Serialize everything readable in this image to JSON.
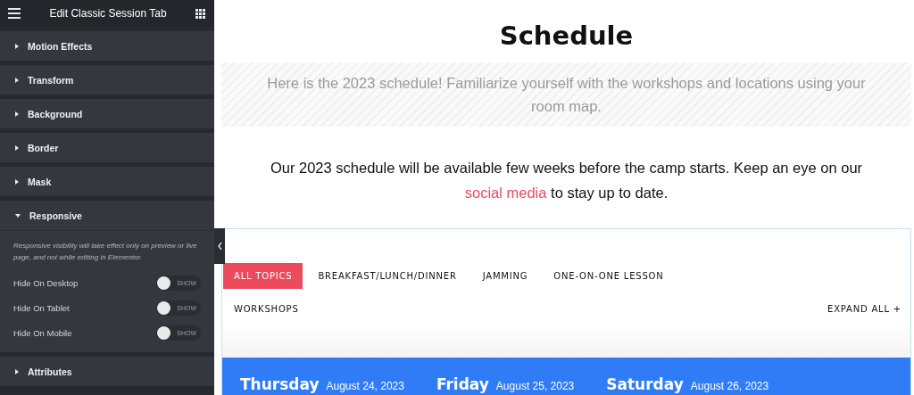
{
  "panel": {
    "title": "Edit Classic Session Tab",
    "sections": [
      {
        "label": "Motion Effects",
        "expanded": false
      },
      {
        "label": "Transform",
        "expanded": false
      },
      {
        "label": "Background",
        "expanded": false
      },
      {
        "label": "Border",
        "expanded": false
      },
      {
        "label": "Mask",
        "expanded": false
      },
      {
        "label": "Responsive",
        "expanded": true,
        "note": "Responsive visibility will take effect only on preview or live page, and not while editing in Elementor.",
        "toggles": [
          {
            "label": "Hide On Desktop",
            "on": false,
            "state": "SHOW"
          },
          {
            "label": "Hide On Tablet",
            "on": false,
            "state": "SHOW"
          },
          {
            "label": "Hide On Mobile",
            "on": false,
            "state": "SHOW"
          }
        ]
      },
      {
        "label": "Attributes",
        "expanded": false
      }
    ]
  },
  "page": {
    "title": "Schedule",
    "intro": "Here is the 2023 schedule! Familiarize yourself with the workshops and locations using your room map.",
    "notice": {
      "before": "Our 2023 schedule will be available few weeks before the camp starts. Keep an eye on our ",
      "link": "social media",
      "after": " to stay up to date."
    },
    "filters": [
      {
        "label": "ALL TOPICS",
        "selected": true
      },
      {
        "label": "BREAKFAST/LUNCH/DINNER",
        "selected": false
      },
      {
        "label": "JAMMING",
        "selected": false
      },
      {
        "label": "ONE-ON-ONE LESSON",
        "selected": false
      },
      {
        "label": "WORKSHOPS",
        "selected": false
      }
    ],
    "expand_all": "EXPAND ALL +",
    "days": [
      {
        "day": "Thursday",
        "date": "August 24, 2023"
      },
      {
        "day": "Friday",
        "date": "August 25, 2023"
      },
      {
        "day": "Saturday",
        "date": "August 26, 2023"
      }
    ]
  }
}
